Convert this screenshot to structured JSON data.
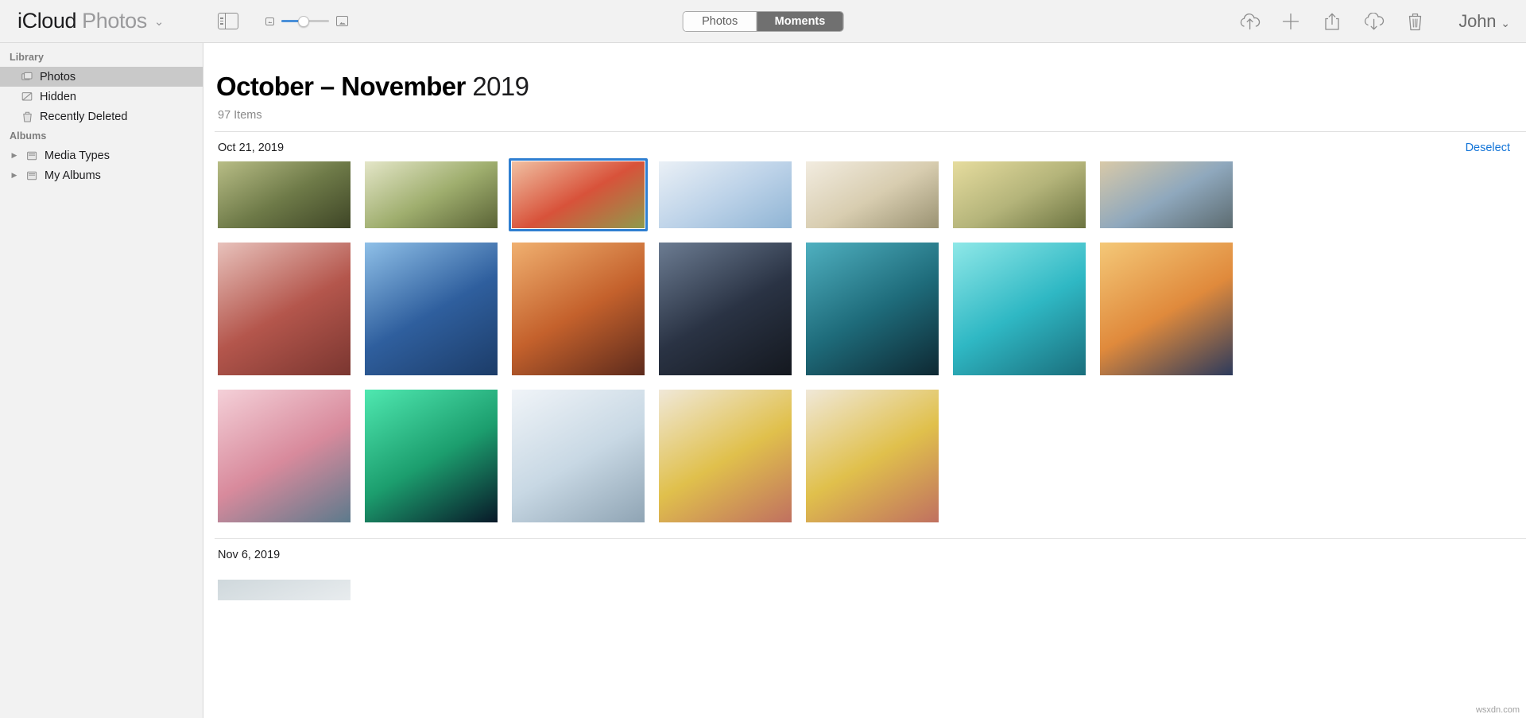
{
  "toolbar": {
    "brand_primary": "iCloud",
    "brand_secondary": "Photos",
    "brand_caret": "⌄",
    "sidebar_toggle_icon": "sidebar-toggle-icon",
    "zoom_small_icon": "small-thumbnail-icon",
    "zoom_large_icon": "large-thumbnail-icon",
    "zoom_slider_value": 42,
    "segmented": {
      "options": [
        "Photos",
        "Moments"
      ],
      "selected": "Moments"
    },
    "actions": [
      {
        "name": "upload-icon",
        "label": "Upload"
      },
      {
        "name": "add-icon",
        "label": "Add"
      },
      {
        "name": "share-icon",
        "label": "Share"
      },
      {
        "name": "download-icon",
        "label": "Download"
      },
      {
        "name": "trash-icon",
        "label": "Delete"
      }
    ],
    "user": {
      "name": "John",
      "caret": "⌄"
    }
  },
  "sidebar": {
    "sections": [
      {
        "title": "Library",
        "items": [
          {
            "label": "Photos",
            "icon": "photos-stack-icon",
            "selected": true
          },
          {
            "label": "Hidden",
            "icon": "hidden-slash-icon",
            "selected": false
          },
          {
            "label": "Recently Deleted",
            "icon": "trash-icon",
            "selected": false
          }
        ]
      },
      {
        "title": "Albums",
        "items": [
          {
            "label": "Media Types",
            "icon": "folder-icon",
            "disclosure": "▶",
            "selected": false
          },
          {
            "label": "My Albums",
            "icon": "folder-icon",
            "disclosure": "▶",
            "selected": false
          }
        ]
      }
    ]
  },
  "main": {
    "title_range": "October – November",
    "title_year": "2019",
    "item_count": "97 Items",
    "groups": [
      {
        "date": "Oct 21, 2019",
        "action_label": "Deselect",
        "rows": [
          [
            {
              "name": "photo-birdhouse-autumn",
              "selected": false,
              "c1": "#6e7a48",
              "c2": "#b8bd86",
              "c3": "#3e4526"
            },
            {
              "name": "photo-blossom-tree",
              "selected": false,
              "c1": "#9fae6e",
              "c2": "#e4e6c8",
              "c3": "#5a6336"
            },
            {
              "name": "photo-red-leaf-hand",
              "selected": true,
              "c1": "#d8523a",
              "c2": "#f0c0a2",
              "c3": "#8f9a4c"
            },
            {
              "name": "photo-blue-sky-clouds",
              "selected": false,
              "c1": "#bcd2e8",
              "c2": "#eaf0f6",
              "c3": "#8fb4d4"
            },
            {
              "name": "photo-white-roses",
              "selected": false,
              "c1": "#d8cdb0",
              "c2": "#f2ece0",
              "c3": "#9a9272"
            },
            {
              "name": "photo-yellow-flower",
              "selected": false,
              "c1": "#b4b47a",
              "c2": "#e6dc9e",
              "c3": "#6b7340"
            },
            {
              "name": "photo-desert-road",
              "selected": false,
              "c1": "#8fa8bd",
              "c2": "#d8c9a8",
              "c3": "#5c6b70"
            }
          ],
          [
            {
              "name": "photo-pink-blossom-wall",
              "selected": false,
              "c1": "#b4564c",
              "c2": "#e8c2bc",
              "c3": "#7a3630"
            },
            {
              "name": "photo-tiny-planet-castle",
              "selected": false,
              "c1": "#2f5f9e",
              "c2": "#8fc0e8",
              "c3": "#1c3c68"
            },
            {
              "name": "photo-sunset-palm-street",
              "selected": false,
              "c1": "#c4612c",
              "c2": "#f0b070",
              "c3": "#5c2a1c"
            },
            {
              "name": "photo-night-city-street",
              "selected": false,
              "c1": "#2a3344",
              "c2": "#6c7c92",
              "c3": "#14181f"
            },
            {
              "name": "photo-city-skyline-dusk",
              "selected": false,
              "c1": "#1e6b7a",
              "c2": "#4fb0c0",
              "c3": "#0e2832"
            },
            {
              "name": "photo-heart-island-lagoon",
              "selected": false,
              "c1": "#2fb8c4",
              "c2": "#8fe8e8",
              "c3": "#1a6e7c"
            },
            {
              "name": "photo-eiffel-tower-sunset",
              "selected": false,
              "c1": "#e08a3c",
              "c2": "#f4c878",
              "c3": "#2c3a5c"
            }
          ],
          [
            {
              "name": "photo-pink-clouds-lake",
              "selected": false,
              "c1": "#d88a9c",
              "c2": "#f4d0d8",
              "c3": "#5c7a8c"
            },
            {
              "name": "photo-aurora-borealis",
              "selected": false,
              "c1": "#1c9e6e",
              "c2": "#4fe8b0",
              "c3": "#081828"
            },
            {
              "name": "photo-snow-forest-river",
              "selected": false,
              "c1": "#c8d8e4",
              "c2": "#f0f4f8",
              "c3": "#8fa4b4"
            },
            {
              "name": "photo-yellow-leaves-wall-1",
              "selected": false,
              "c1": "#e0c04c",
              "c2": "#f0e8d8",
              "c3": "#c07060"
            },
            {
              "name": "photo-yellow-leaves-wall-2",
              "selected": false,
              "c1": "#e0c04c",
              "c2": "#f0e8d8",
              "c3": "#c07060"
            }
          ]
        ]
      },
      {
        "date": "Nov 6, 2019",
        "action_label": "",
        "rows": []
      }
    ]
  },
  "watermark": "wsxdn.com"
}
